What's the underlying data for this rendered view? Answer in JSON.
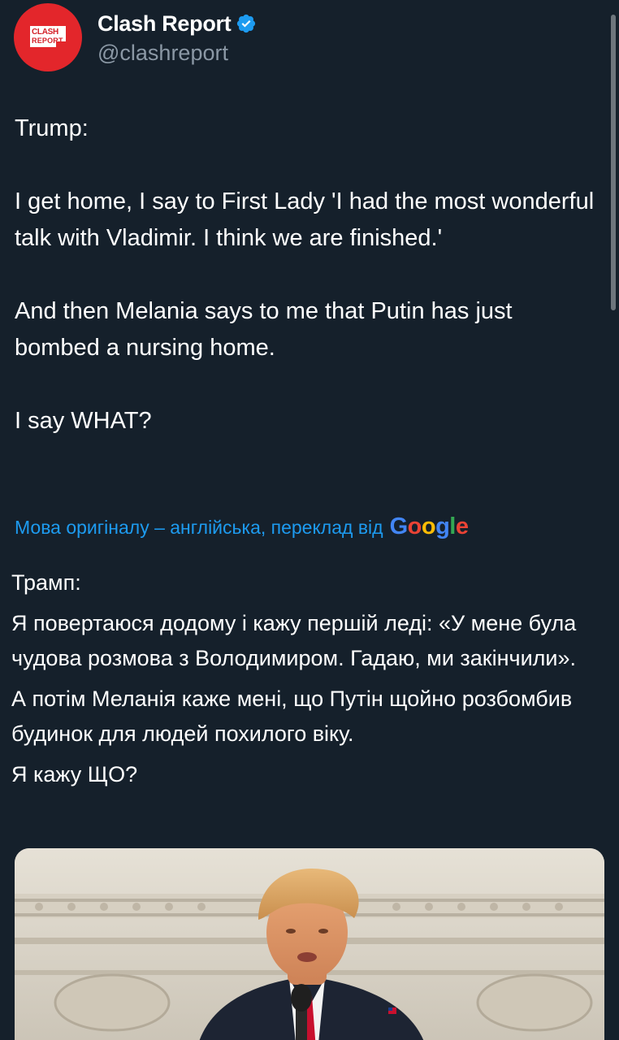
{
  "author": {
    "display_name": "Clash Report",
    "handle": "@clashreport",
    "avatar_text_line1": "CLASH",
    "avatar_text_line2": "REPORT",
    "verified": true
  },
  "tweet": {
    "paragraphs": [
      "Trump:",
      "I get home, I say to First Lady 'I had the most wonderful talk with Vladimir. I think we are finished.'",
      "And then Melania says to me that Putin has just bombed a nursing home.",
      "I say WHAT?"
    ]
  },
  "translation": {
    "notice": "Мова оригіналу – англійська, переклад від",
    "provider": "Google",
    "paragraphs": [
      "Трамп:",
      "Я повертаюся додому і кажу першій леді: «У мене була чудова розмова з Володимиром. Гадаю, ми закінчили».",
      "А потім Меланія каже мені, що Путін щойно розбомбив будинок для людей похилого віку.",
      "Я кажу ЩО?"
    ]
  },
  "colors": {
    "background": "#15202b",
    "accent": "#1d9bf0",
    "avatar": "#e3262b",
    "secondary_text": "#8b98a5"
  },
  "icons": {
    "verified": "verified-badge-icon"
  }
}
